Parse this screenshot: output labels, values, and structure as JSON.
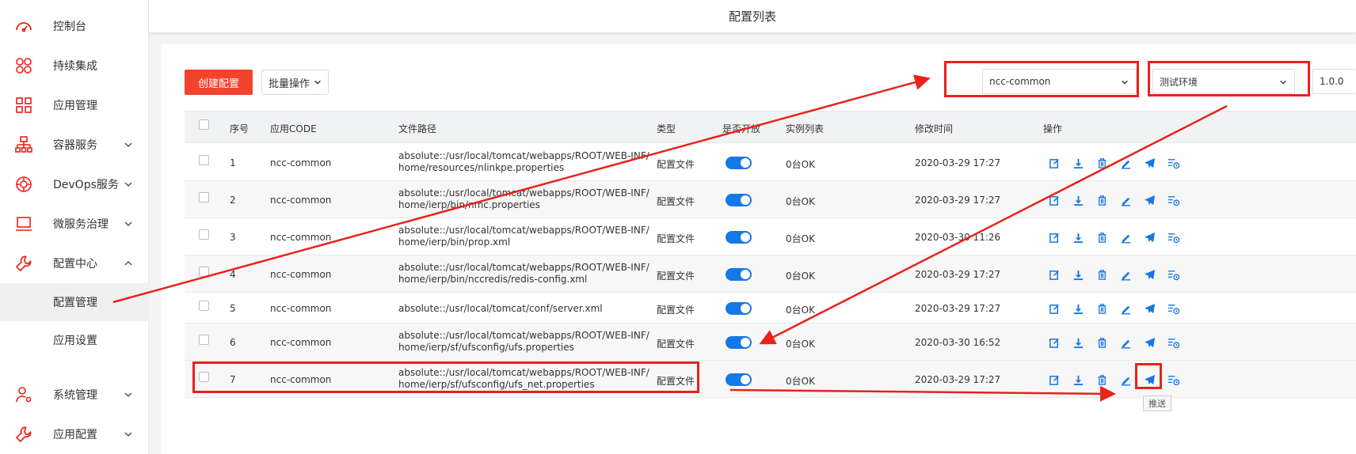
{
  "colors": {
    "accent": "#1677e6",
    "danger": "#f2432d",
    "annotation": "#e8221c"
  },
  "header": {
    "title": "配置列表"
  },
  "sidebar": {
    "items": [
      {
        "label": "控制台",
        "icon": "dashboard-icon"
      },
      {
        "label": "持续集成",
        "icon": "integration-icon"
      },
      {
        "label": "应用管理",
        "icon": "apps-icon"
      },
      {
        "label": "容器服务",
        "icon": "container-icon"
      },
      {
        "label": "DevOps服务",
        "icon": "devops-icon"
      },
      {
        "label": "微服务治理",
        "icon": "laptop-icon"
      },
      {
        "label": "配置中心",
        "icon": "wrench-icon"
      },
      {
        "label": "系统管理",
        "icon": "user-gear-icon"
      },
      {
        "label": "应用配置",
        "icon": "wrench-icon"
      }
    ],
    "subitems": [
      {
        "label": "配置管理"
      },
      {
        "label": "应用设置"
      }
    ]
  },
  "toolbar": {
    "create_label": "创建配置",
    "batch_label": "批量操作",
    "app_select": "ncc-common",
    "env_select": "测试环境",
    "version_select": "1.0.0"
  },
  "table": {
    "headers": [
      "序号",
      "应用CODE",
      "文件路径",
      "类型",
      "是否开放",
      "实例列表",
      "修改时间",
      "操作"
    ],
    "rows": [
      {
        "no": "1",
        "code": "ncc-common",
        "path": "absolute::/usr/local/tomcat/webapps/ROOT/WEB-INF/home/resources/nlinkpe.properties",
        "type": "配置文件",
        "instances": "0台OK",
        "time": "2020-03-29 17:27"
      },
      {
        "no": "2",
        "code": "ncc-common",
        "path": "absolute::/usr/local/tomcat/webapps/ROOT/WEB-INF/home/ierp/bin/nmc.properties",
        "type": "配置文件",
        "instances": "0台OK",
        "time": "2020-03-29 17:27"
      },
      {
        "no": "3",
        "code": "ncc-common",
        "path": "absolute::/usr/local/tomcat/webapps/ROOT/WEB-INF/home/ierp/bin/prop.xml",
        "type": "配置文件",
        "instances": "0台OK",
        "time": "2020-03-30 11:26"
      },
      {
        "no": "4",
        "code": "ncc-common",
        "path": "absolute::/usr/local/tomcat/webapps/ROOT/WEB-INF/home/ierp/bin/nccredis/redis-config.xml",
        "type": "配置文件",
        "instances": "0台OK",
        "time": "2020-03-29 17:27"
      },
      {
        "no": "5",
        "code": "ncc-common",
        "path": "absolute::/usr/local/tomcat/conf/server.xml",
        "type": "配置文件",
        "instances": "0台OK",
        "time": "2020-03-29 17:27"
      },
      {
        "no": "6",
        "code": "ncc-common",
        "path": "absolute::/usr/local/tomcat/webapps/ROOT/WEB-INF/home/ierp/sf/ufsconfig/ufs.properties",
        "type": "配置文件",
        "instances": "0台OK",
        "time": "2020-03-30 16:52"
      },
      {
        "no": "7",
        "code": "ncc-common",
        "path": "absolute::/usr/local/tomcat/webapps/ROOT/WEB-INF/home/ierp/sf/ufsconfig/ufs_net.properties",
        "type": "配置文件",
        "instances": "0台OK",
        "time": "2020-03-29 17:27"
      }
    ],
    "actions": [
      "edit-icon",
      "download-icon",
      "delete-icon",
      "pencil-icon",
      "push-icon",
      "history-icon"
    ]
  },
  "tooltip": {
    "text": "推送"
  }
}
